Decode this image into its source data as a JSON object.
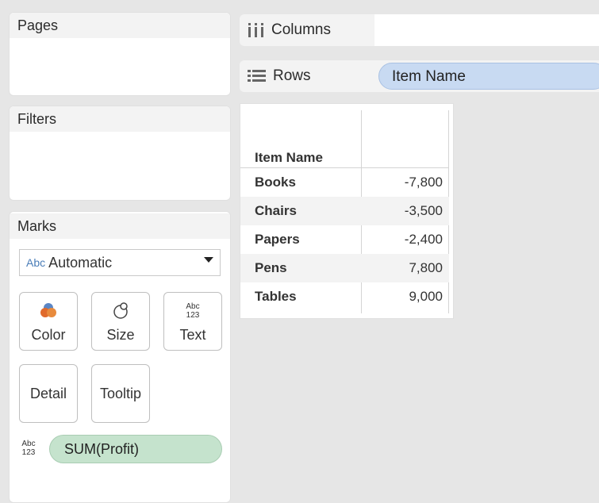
{
  "cards": {
    "pages": {
      "title": "Pages"
    },
    "filters": {
      "title": "Filters"
    },
    "marks": {
      "title": "Marks",
      "mark_type": {
        "icon_text": "Abc",
        "value": "Automatic"
      },
      "buttons": {
        "color": "Color",
        "size": "Size",
        "text": "Text",
        "detail": "Detail",
        "tooltip": "Tooltip"
      },
      "field_pill": "SUM(Profit)"
    }
  },
  "shelves": {
    "columns": {
      "label": "Columns",
      "pills": []
    },
    "rows": {
      "label": "Rows",
      "pill": "Item Name"
    }
  },
  "table": {
    "row_header": "Item Name",
    "rows": [
      {
        "name": "Books",
        "value": "-7,800"
      },
      {
        "name": "Chairs",
        "value": "-3,500"
      },
      {
        "name": "Papers",
        "value": "-2,400"
      },
      {
        "name": "Pens",
        "value": "7,800"
      },
      {
        "name": "Tables",
        "value": "9,000"
      }
    ]
  },
  "colors": {
    "rows_pill": "#c8daf2",
    "measure_pill": "#c5e3cd",
    "background": "#e6e6e6"
  }
}
